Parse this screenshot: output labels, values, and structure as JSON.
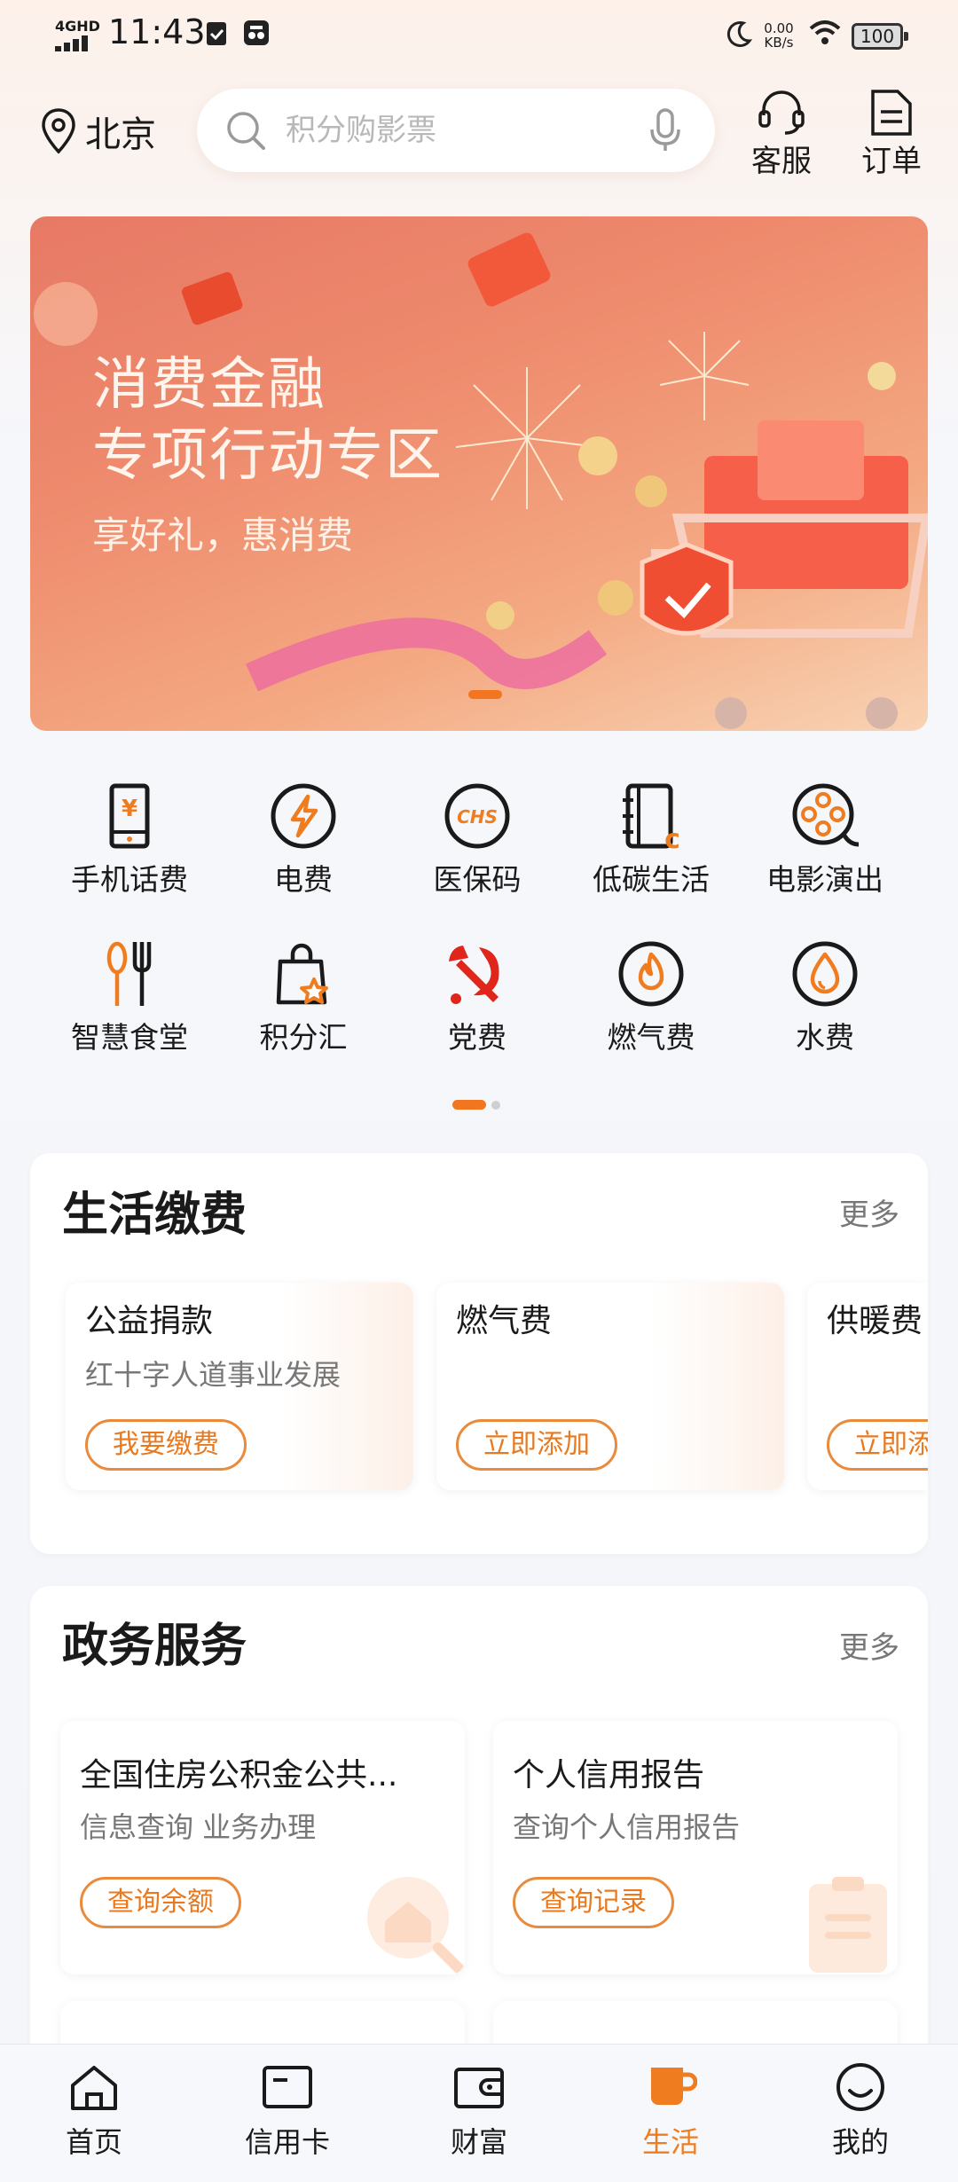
{
  "status_bar": {
    "network": "4GHD",
    "time": "11:43",
    "speed_value": "0.00",
    "speed_unit": "KB/s",
    "battery": "100"
  },
  "header": {
    "city": "北京",
    "search_placeholder": "积分购影票",
    "service_label": "客服",
    "orders_label": "订单"
  },
  "banner": {
    "title_line1": "消费金融",
    "title_line2": "专项行动专区",
    "subtitle": "享好礼，惠消费"
  },
  "quick_grid": {
    "items": [
      {
        "label": "手机话费",
        "icon": "phone-bill-icon"
      },
      {
        "label": "电费",
        "icon": "electricity-icon"
      },
      {
        "label": "医保码",
        "icon": "chs-medical-icon"
      },
      {
        "label": "低碳生活",
        "icon": "low-carbon-icon"
      },
      {
        "label": "电影演出",
        "icon": "film-reel-icon"
      },
      {
        "label": "智慧食堂",
        "icon": "canteen-icon"
      },
      {
        "label": "积分汇",
        "icon": "points-bag-icon"
      },
      {
        "label": "党费",
        "icon": "party-emblem-icon"
      },
      {
        "label": "燃气费",
        "icon": "gas-flame-icon"
      },
      {
        "label": "水费",
        "icon": "water-drop-icon"
      }
    ]
  },
  "life_payment": {
    "title": "生活缴费",
    "more": "更多",
    "cards": [
      {
        "title": "公益捐款",
        "desc": "红十字人道事业发展",
        "button": "我要缴费"
      },
      {
        "title": "燃气费",
        "desc": "",
        "button": "立即添加"
      },
      {
        "title": "供暖费",
        "desc": "",
        "button": "立即添加"
      }
    ]
  },
  "gov_service": {
    "title": "政务服务",
    "more": "更多",
    "cards": [
      {
        "title": "全国住房公积金公共...",
        "desc": "信息查询 业务办理",
        "button": "查询余额"
      },
      {
        "title": "个人信用报告",
        "desc": "查询个人信用报告",
        "button": "查询记录"
      }
    ]
  },
  "tabbar": {
    "items": [
      {
        "label": "首页",
        "active": false
      },
      {
        "label": "信用卡",
        "active": false
      },
      {
        "label": "财富",
        "active": false
      },
      {
        "label": "生活",
        "active": true
      },
      {
        "label": "我的",
        "active": false
      }
    ]
  },
  "colors": {
    "accent": "#ef7d20",
    "banner_start": "#e77965",
    "banner_end": "#f8d3b4"
  }
}
